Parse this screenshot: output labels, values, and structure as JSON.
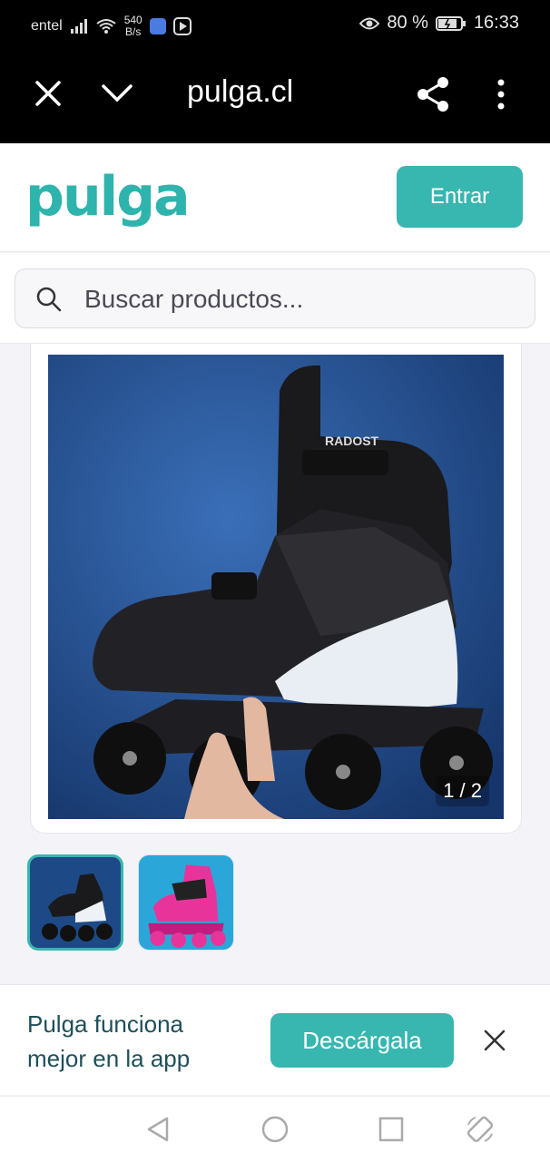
{
  "status_bar": {
    "carrier": "entel",
    "net_speed_value": "540",
    "net_speed_unit": "B/s",
    "battery": "80 %",
    "time": "16:33",
    "icons": [
      "signal-icon",
      "wifi-icon",
      "music-app-icon",
      "play-app-icon",
      "eye-icon",
      "battery-icon"
    ]
  },
  "browser": {
    "url": "pulga.cl",
    "icons": [
      "close-icon",
      "chevron-down-icon",
      "share-icon",
      "more-vert-icon"
    ]
  },
  "header": {
    "logo": "pulga",
    "login_label": "Entrar",
    "brand_color": "#38b6b0"
  },
  "search": {
    "placeholder": "Buscar productos...",
    "value": ""
  },
  "product": {
    "image_counter": "1 / 2",
    "brand_text": "RADOST",
    "thumbnails": [
      "black-skate",
      "pink-skate"
    ],
    "selected_thumbnail": 1
  },
  "app_banner": {
    "text": "Pulga funciona mejor en la app",
    "button_label": "Descárgala"
  },
  "navbar": {
    "icons": [
      "back-icon",
      "home-icon",
      "recents-icon",
      "rotate-icon"
    ]
  }
}
